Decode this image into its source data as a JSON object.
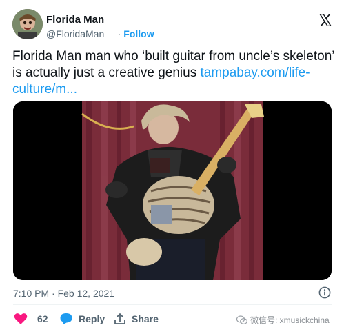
{
  "author": {
    "name": "Florida Man",
    "handle": "@FloridaMan__",
    "separator": "·",
    "follow_label": "Follow"
  },
  "tweet": {
    "text": "Florida Man man who ‘built guitar from uncle’s skeleton’ is actually just a creative genius ",
    "link_text": "tampabay.com/life-culture/m...",
    "timestamp": "7:10 PM · Feb 12, 2021"
  },
  "actions": {
    "like_count": "62",
    "reply_label": "Reply",
    "share_label": "Share"
  },
  "watermark": {
    "text": "微信号: xmusickchina"
  },
  "colors": {
    "accent": "#1d9bf0",
    "like": "#f91880",
    "reply": "#1d9bf0",
    "muted": "#536471"
  },
  "icons": [
    "x-logo-icon",
    "info-icon",
    "heart-icon",
    "reply-bubble-icon",
    "share-icon",
    "wechat-icon"
  ]
}
